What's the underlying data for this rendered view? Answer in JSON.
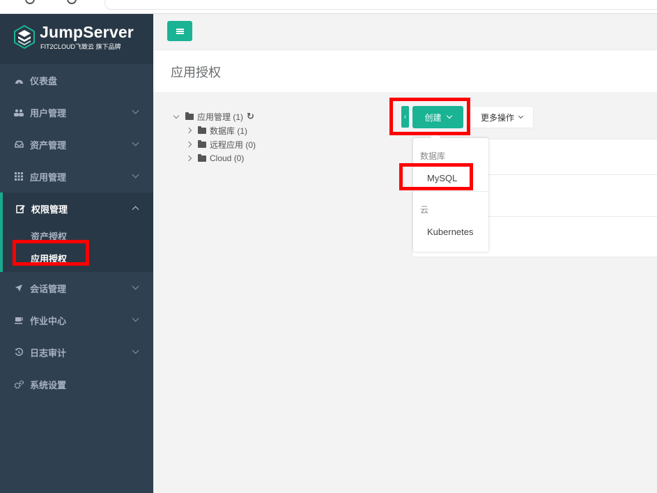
{
  "brand": {
    "title": "JumpServer",
    "subtitle": "FIT2CLOUD飞致云 旗下品牌"
  },
  "sidebar": {
    "items": [
      {
        "label": "仪表盘",
        "icon": "dashboard-icon"
      },
      {
        "label": "用户管理",
        "icon": "users-icon"
      },
      {
        "label": "资产管理",
        "icon": "inbox-icon"
      },
      {
        "label": "应用管理",
        "icon": "grid-icon"
      },
      {
        "label": "权限管理",
        "icon": "edit-icon",
        "expanded": true,
        "children": [
          {
            "label": "资产授权"
          },
          {
            "label": "应用授权",
            "active": true
          }
        ]
      },
      {
        "label": "会话管理",
        "icon": "rocket-icon"
      },
      {
        "label": "作业中心",
        "icon": "coffee-icon"
      },
      {
        "label": "日志审计",
        "icon": "history-icon"
      },
      {
        "label": "系统设置",
        "icon": "cogs-icon"
      }
    ]
  },
  "page": {
    "title": "应用授权"
  },
  "tree": {
    "root": {
      "label": "应用管理 (1)"
    },
    "children": [
      {
        "label": "数据库 (1)"
      },
      {
        "label": "远程应用 (0)"
      },
      {
        "label": "Cloud (0)"
      }
    ]
  },
  "toolbar": {
    "toggle_label": "‹",
    "create_label": "创建",
    "more_label": "更多操作"
  },
  "dropdown": {
    "groups": [
      {
        "header": "数据库",
        "items": [
          "MySQL"
        ]
      },
      {
        "header": "云",
        "items": [
          "Kubernetes"
        ]
      }
    ]
  },
  "colors": {
    "sidebar_bg": "#2f4050",
    "accent": "#1ab394",
    "annotation": "#ff0000"
  }
}
